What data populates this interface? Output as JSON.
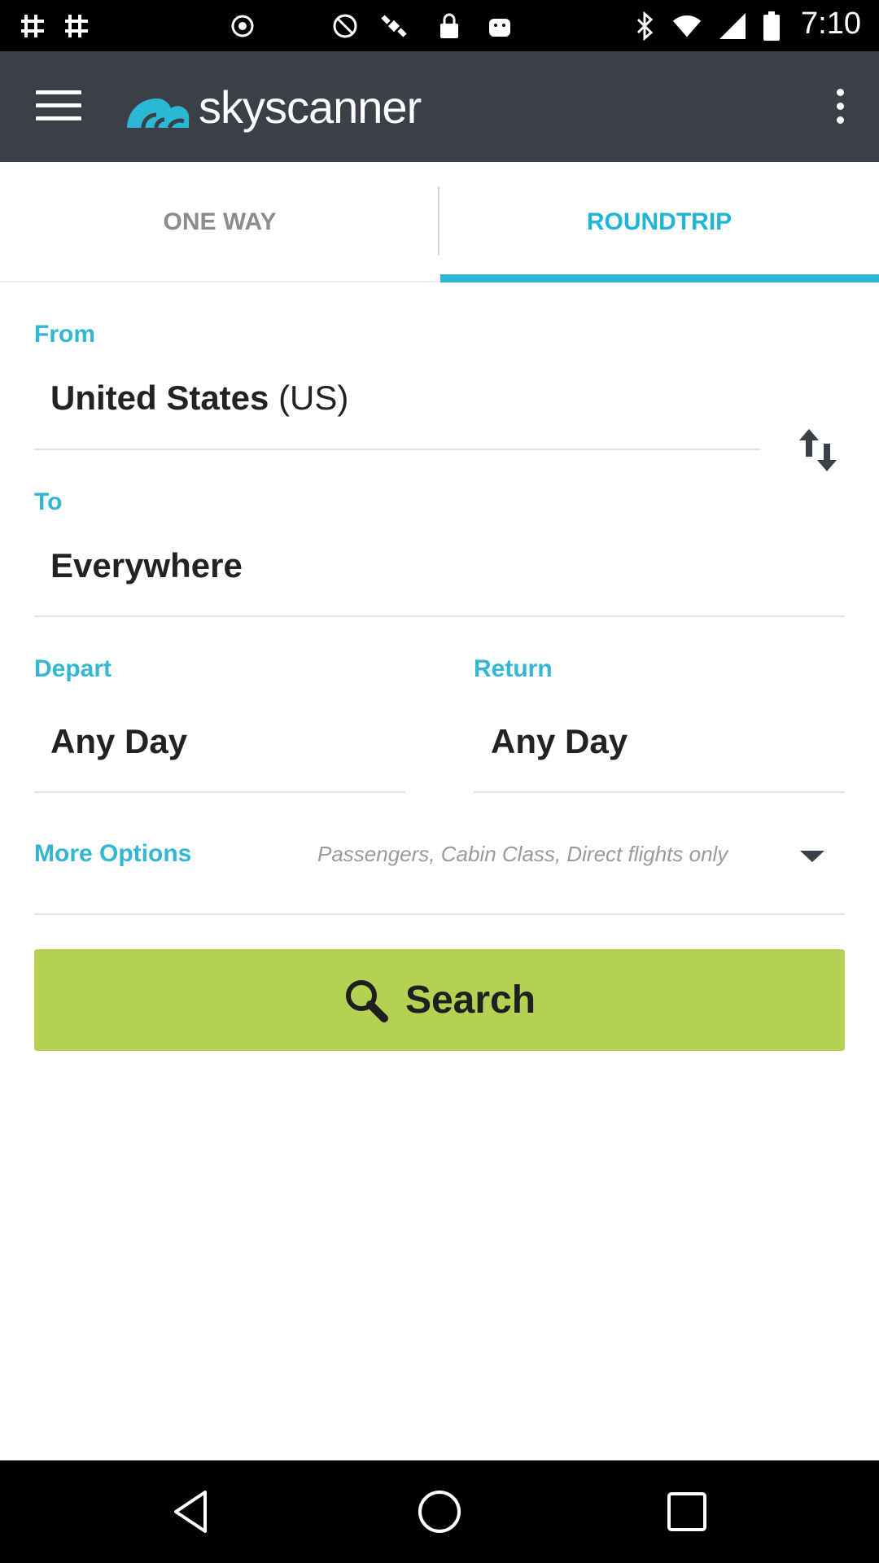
{
  "status_bar": {
    "time": "7:10",
    "icons": [
      "hashtag-icon",
      "hashtag-icon",
      "record-icon",
      "blocked-icon",
      "satellite-icon",
      "lock-icon",
      "android-icon",
      "bluetooth-icon",
      "wifi-icon",
      "signal-icon",
      "battery-icon"
    ]
  },
  "app_bar": {
    "logo_text": "skyscanner",
    "brand_color": "#3b4048"
  },
  "tabs": [
    {
      "label": "ONE WAY",
      "active": false
    },
    {
      "label": "ROUNDTRIP",
      "active": true
    }
  ],
  "form": {
    "from_label": "From",
    "from_value_main": "United States",
    "from_value_code": "(US)",
    "to_label": "To",
    "to_value": "Everywhere",
    "depart_label": "Depart",
    "depart_value": "Any Day",
    "return_label": "Return",
    "return_value": "Any Day",
    "more_options_label": "More Options",
    "more_options_hint": "Passengers, Cabin Class, Direct flights only"
  },
  "search_button": {
    "label": "Search",
    "color": "#b5d154"
  },
  "accent_color": "#33b6d3"
}
